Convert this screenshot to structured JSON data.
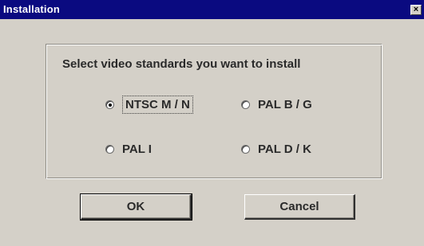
{
  "window": {
    "title": "Installation",
    "close_glyph": "×"
  },
  "prompt": "Select video standards you want to install",
  "options": [
    {
      "label": "NTSC M / N",
      "selected": true
    },
    {
      "label": "PAL B / G",
      "selected": false
    },
    {
      "label": "PAL I",
      "selected": false
    },
    {
      "label": "PAL D / K",
      "selected": false
    }
  ],
  "buttons": {
    "ok": "OK",
    "cancel": "Cancel"
  }
}
